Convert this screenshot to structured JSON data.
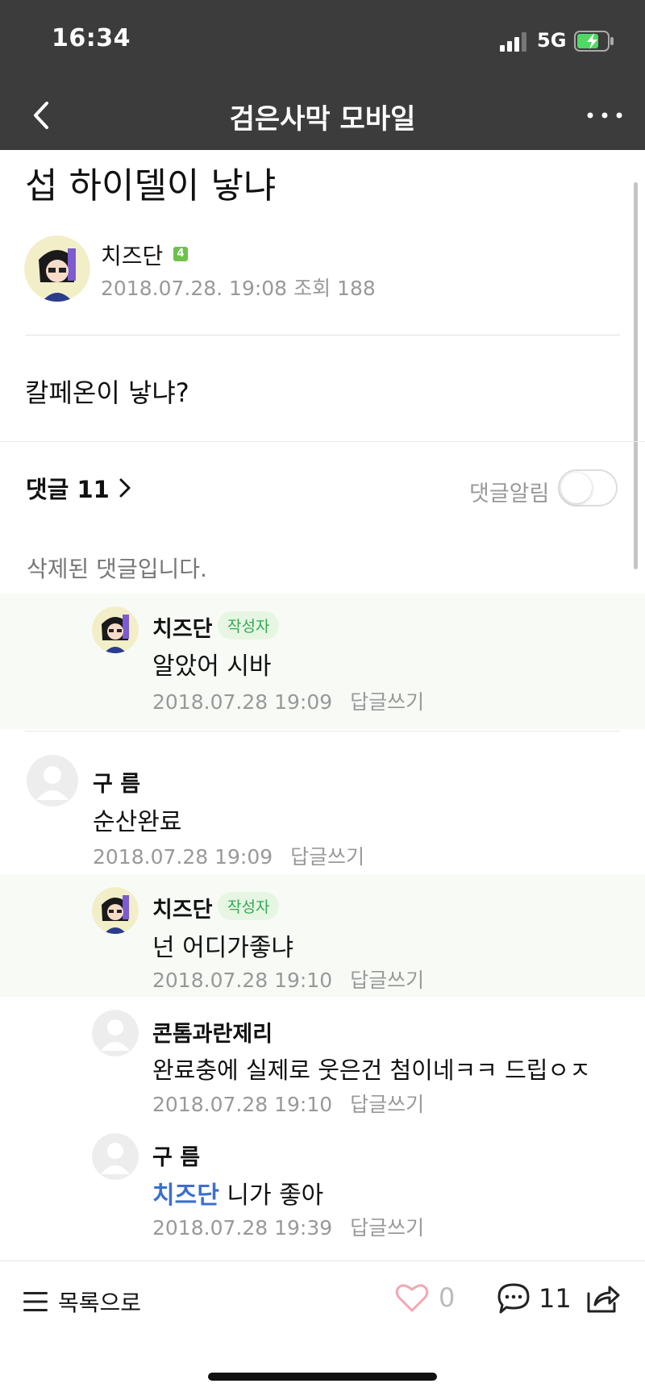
{
  "status": {
    "time": "16:34",
    "network": "5G"
  },
  "nav": {
    "title": "검은사막 모바일"
  },
  "post": {
    "title": "섭 하이델이 낳냐",
    "author": "치즈단",
    "level": "4",
    "date": "2018.07.28. 19:08",
    "views": "조회 188",
    "body": "칼페온이 낳냐?"
  },
  "comments_header": {
    "label": "댓글 11",
    "notify_label": "댓글알림",
    "notify_on": false
  },
  "comments": {
    "deleted_text": "삭제된 댓글입니다.",
    "c1": {
      "name": "치즈단",
      "tag": "작성자",
      "text": "알았어 시바",
      "time": "2018.07.28 19:09",
      "reply": "답글쓰기"
    },
    "c2": {
      "name": "구 름",
      "text": "순산완료",
      "time": "2018.07.28 19:09",
      "reply": "답글쓰기"
    },
    "c3": {
      "name": "치즈단",
      "tag": "작성자",
      "text": "넌 어디가좋냐",
      "time": "2018.07.28 19:10",
      "reply": "답글쓰기"
    },
    "c4": {
      "name": "콘톰과란제리",
      "text": "완료충에 실제로 웃은건 첨이네ㅋㅋ 드립ㅇㅈ",
      "time": "2018.07.28 19:10",
      "reply": "답글쓰기"
    },
    "c5": {
      "name": "구 름",
      "mention": "치즈단",
      "text": " 니가 좋아",
      "time": "2018.07.28 19:39",
      "reply": "답글쓰기"
    }
  },
  "bottom": {
    "list_label": "목록으로",
    "likes": "0",
    "comments": "11"
  },
  "colors": {
    "header_bg": "#3c3c3c",
    "accent_green": "#34a853",
    "mention_blue": "#3b6fd2"
  },
  "icons": [
    "back-icon",
    "more-icon",
    "signal-icon",
    "battery-icon",
    "chevron-right-icon",
    "menu-icon",
    "heart-icon",
    "comment-icon",
    "share-icon"
  ]
}
